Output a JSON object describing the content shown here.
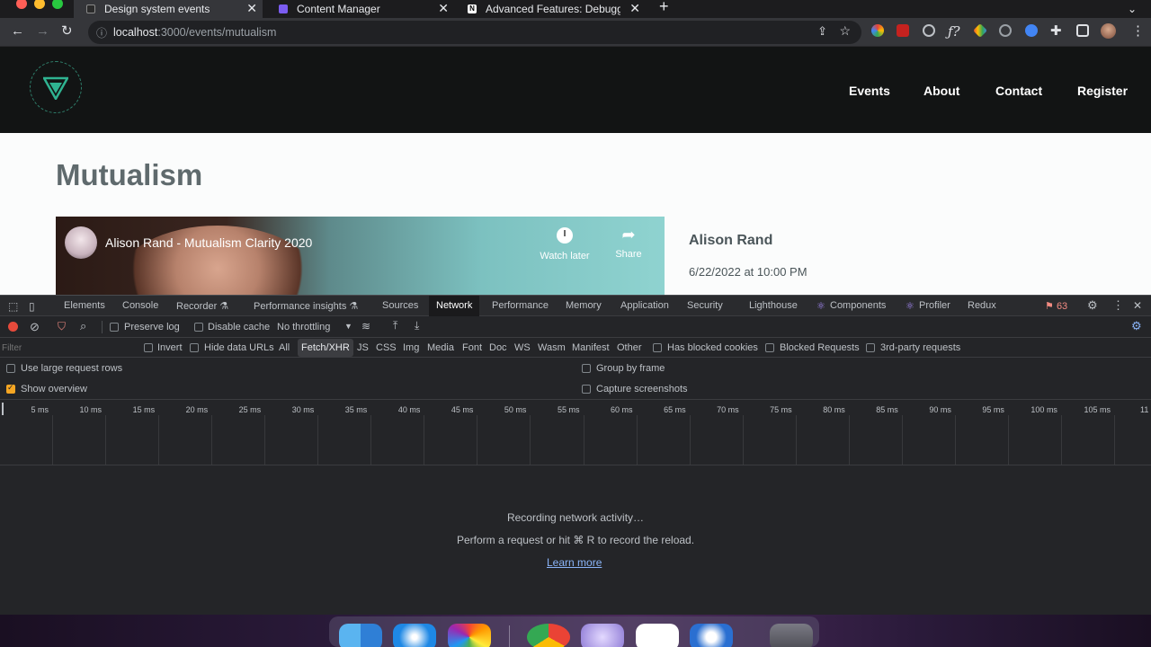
{
  "browser": {
    "tabs": [
      {
        "title": "Design system events",
        "favicon": "#2b2b2b"
      },
      {
        "title": "Content Manager",
        "favicon": "#7b5cf0"
      },
      {
        "title": "Advanced Features: Debugging",
        "favicon": "#ffffff"
      }
    ],
    "url_host": "localhost",
    "url_path": ":3000/events/mutualism"
  },
  "site": {
    "nav": [
      "Events",
      "About",
      "Contact",
      "Register"
    ],
    "title": "Mutualism",
    "video": {
      "title": "Alison Rand - Mutualism Clarity 2020",
      "watch_later": "Watch later",
      "share": "Share"
    },
    "speaker": "Alison Rand",
    "date": "6/22/2022 at 10:00 PM",
    "colors": {
      "header_bg": "#121414",
      "title": "#5f6a6d"
    }
  },
  "devtools": {
    "tabs": [
      "Elements",
      "Console",
      "Recorder ⚗",
      "Performance insights ⚗",
      "Sources",
      "Network",
      "Performance",
      "Memory",
      "Application",
      "Security",
      "Lighthouse",
      "Components",
      "Profiler",
      "Redux"
    ],
    "selected_tab": "Network",
    "issues_count": "63",
    "toolbar": {
      "preserve_log": "Preserve log",
      "disable_cache": "Disable cache",
      "throttling": "No throttling"
    },
    "filter": {
      "placeholder": "Filter",
      "invert": "Invert",
      "hide_data_urls": "Hide data URLs",
      "types": [
        "All",
        "Fetch/XHR",
        "JS",
        "CSS",
        "Img",
        "Media",
        "Font",
        "Doc",
        "WS",
        "Wasm",
        "Manifest",
        "Other"
      ],
      "selected_type": "Fetch/XHR",
      "blocked_cookies": "Has blocked cookies",
      "blocked_requests": "Blocked Requests",
      "third_party": "3rd-party requests"
    },
    "options": {
      "large_rows": "Use large request rows",
      "show_overview": "Show overview",
      "group_by_frame": "Group by frame",
      "capture_screenshots": "Capture screenshots",
      "show_overview_checked": true
    },
    "timeline_ticks": [
      "5 ms",
      "10 ms",
      "15 ms",
      "20 ms",
      "25 ms",
      "30 ms",
      "35 ms",
      "40 ms",
      "45 ms",
      "50 ms",
      "55 ms",
      "60 ms",
      "65 ms",
      "70 ms",
      "75 ms",
      "80 ms",
      "85 ms",
      "90 ms",
      "95 ms",
      "100 ms",
      "105 ms",
      "11"
    ],
    "empty": {
      "recording": "Recording network activity…",
      "hint": "Perform a request or hit ⌘ R to record the reload.",
      "learn_more": "Learn more"
    }
  }
}
